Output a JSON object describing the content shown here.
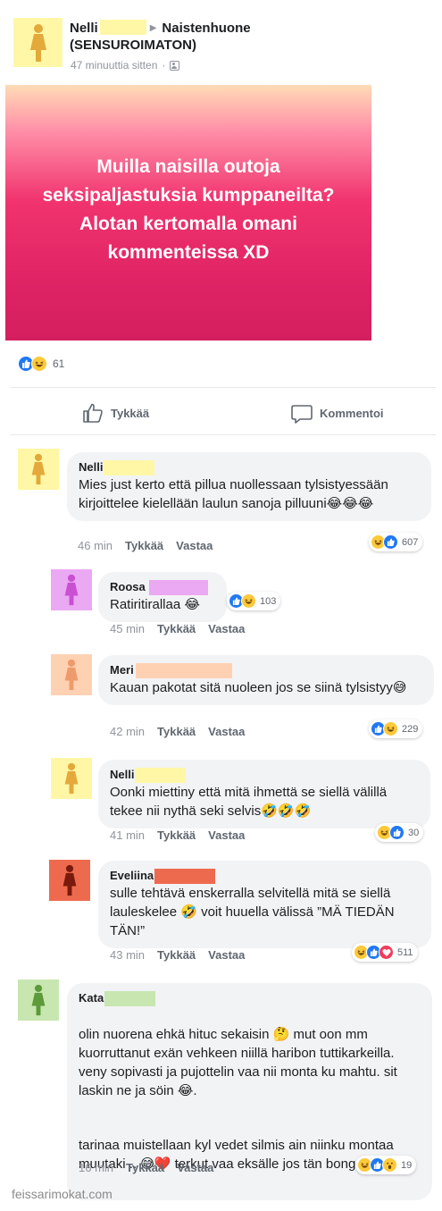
{
  "post": {
    "author": "Nelli",
    "group": "Naistenhuone (SENSUROIMATON)",
    "time": "47 minuuttia sitten",
    "banner_text": "Muilla naisilla outoja seksipaljastuksia kumppaneilta? Alotan kertomalla omani kommenteissa XD",
    "reaction_count": "61",
    "like_label": "Tykkää",
    "comment_label": "Kommentoi",
    "colors": {
      "banner_top": "#ffdcb6",
      "banner_mid": "#f1346f",
      "banner_bottom": "#d41f5e",
      "like": "#2078f4",
      "author_avatar": "#fff7a6"
    }
  },
  "comments": [
    {
      "name": "Nelli",
      "text": "Mies just kerto että pillua nuollessaan tylsistyessään kirjoittelee kielellään laulun sanoja pilluuni😂😂😂",
      "time": "46 min",
      "like": "Tykkää",
      "reply": "Vastaa",
      "reactions": [
        "haha",
        "like"
      ],
      "count": "607",
      "avatar_color": "#fff7a6"
    },
    {
      "name": "Roosa",
      "text": "Ratiritirallaa 😂",
      "time": "45 min",
      "like": "Tykkää",
      "reply": "Vastaa",
      "reactions": [
        "like",
        "haha"
      ],
      "count": "103",
      "avatar_color": "#eba8f3"
    },
    {
      "name": "Meri",
      "text": "Kauan pakotat sitä nuoleen jos se siinä tylsistyy😅",
      "time": "42 min",
      "like": "Tykkää",
      "reply": "Vastaa",
      "reactions": [
        "like",
        "haha"
      ],
      "count": "229",
      "avatar_color": "#ffd1b3"
    },
    {
      "name": "Nelli",
      "text": "Oonki miettiny että mitä ihmettä se siellä välillä tekee nii nythä seki selvis🤣🤣🤣",
      "time": "41 min",
      "like": "Tykkää",
      "reply": "Vastaa",
      "reactions": [
        "haha",
        "like"
      ],
      "count": "30",
      "avatar_color": "#fff7a6"
    },
    {
      "name": "Eveliina",
      "text": "sulle tehtävä enskerralla selvitellä mitä se siellä lauleskelee 🤣 voit huuella välissä ”MÄ TIEDÄN TÄN!”",
      "time": "43 min",
      "like": "Tykkää",
      "reply": "Vastaa",
      "reactions": [
        "haha",
        "like",
        "love"
      ],
      "count": "511",
      "avatar_color": "#ee6a4f"
    },
    {
      "name": "Kata",
      "text_p1": "olin nuorena ehkä hituc sekaisin 🤔 mut oon mm kuorruttanut exän vehkeen niillä haribon tuttikarkeilla. veny sopivasti ja pujottelin vaa nii monta ku mahtu. sit laskin ne ja söin 😂.",
      "text_p2": "tarinaa muistellaan kyl vedet silmis ain niinku montaa muutaki .. 😅❤️ terkut vaa eksälle jos tän bongaat 👏",
      "time": "16 min",
      "like": "Tykkää",
      "reply": "Vastaa",
      "reactions": [
        "haha",
        "like",
        "wow"
      ],
      "count": "19",
      "avatar_color": "#c8e6b0"
    }
  ],
  "watermark": "feissarimokat.com"
}
